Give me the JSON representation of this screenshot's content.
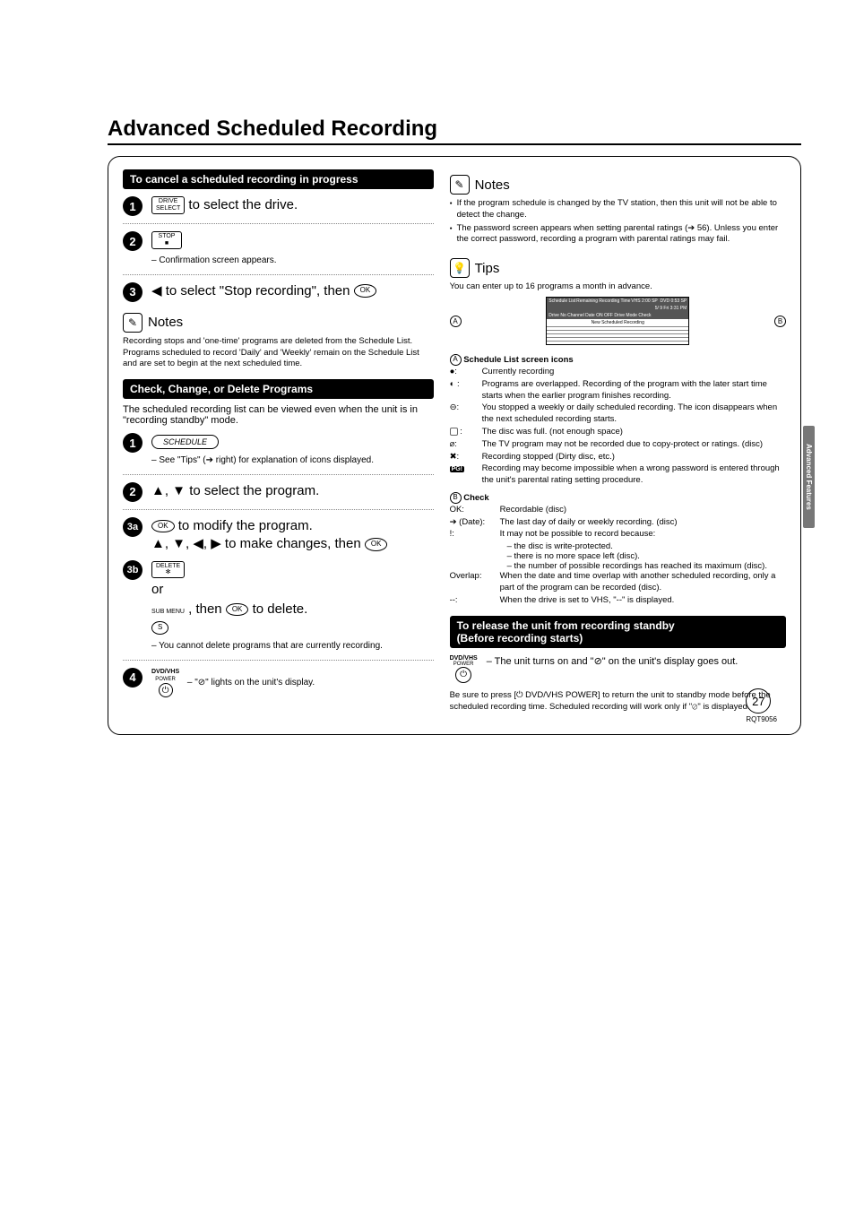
{
  "title": "Advanced Scheduled Recording",
  "side_tab": "Advanced Features",
  "page_number": "27",
  "page_code": "RQT9056",
  "left": {
    "cancel_heading": "To cancel a scheduled recording in progress",
    "step1_btn_top": "DRIVE",
    "step1_btn_bot": "SELECT",
    "step1_text": " to select the drive.",
    "step2_btn_top": "STOP",
    "step2_btn_sym": "■",
    "step2_sub": "– Confirmation screen appears.",
    "step3_text_a": "◀ to select \"Stop recording\", then ",
    "ok_label": "OK",
    "notes_heading": "Notes",
    "notes_body": "Recording stops and 'one-time' programs are deleted from the Schedule List.  Programs scheduled to record 'Daily' and 'Weekly' remain on the Schedule List and are set to begin at the next scheduled time.",
    "check_heading": "Check, Change, or Delete Programs",
    "check_intro": "The scheduled recording list can be viewed even when the unit is in \"recording standby\" mode.",
    "sched_btn": "SCHEDULE",
    "step1b_sub": "– See \"Tips\" (➔ right) for explanation of icons displayed.",
    "step2b_text": "▲, ▼ to select the program.",
    "step3a_text1": " to modify the program.",
    "step3a_text2": "▲, ▼, ◀, ▶ to make changes, then ",
    "step3b_del": "DELETE",
    "step3b_del_sym": "✻",
    "step3b_or": "or",
    "step3b_sub": "SUB MENU",
    "step3b_s": "S",
    "step3b_text": ", then ",
    "step3b_text2": " to delete.",
    "step3b_note": "– You cannot delete programs that are currently recording.",
    "step4_btn1": "DVD/VHS",
    "step4_btn2": "POWER",
    "step4_text": "– \"⊘\" lights on the unit's display."
  },
  "right": {
    "notes_heading": "Notes",
    "notes_items": [
      "If the program schedule is changed by the TV station, then this unit will not be able to detect the change.",
      "The password screen appears when setting parental ratings (➔ 56). Unless you enter the correct password, recording a program with parental ratings may fail."
    ],
    "tips_heading": "Tips",
    "tips_intro": "You can enter up to 16 programs a month in advance.",
    "table": {
      "title": "Schedule List",
      "remain": "Remaining Recording Time",
      "vhs": "VHS  2:00 SP",
      "dvd": "DVD  0:53 SP",
      "date_line": "5/ 9 Fri    3:31 PM",
      "cols": "Drive  No  Channel       Date           ON          OFF       Drive   Mode   Check",
      "empty": "New Scheduled Recording"
    },
    "letter_a": "A",
    "letter_b": "B",
    "a_heading": "Schedule List screen icons",
    "icons": [
      {
        "ic": "●:",
        "tx": "Currently recording"
      },
      {
        "ic": "◐ :",
        "tx": "Programs are overlapped. Recording of the program with the later start time starts when the earlier program finishes recording."
      },
      {
        "ic": "⊖:",
        "tx": "You stopped a weekly or daily scheduled recording. The icon disappears when the next scheduled recording starts."
      },
      {
        "ic": "F :",
        "tx": "The disc was full. (not enough space)"
      },
      {
        "ic": "⌀:",
        "tx": "The TV program may not be recorded due to copy-protect or ratings. (disc)"
      },
      {
        "ic": "✖:",
        "tx": "Recording stopped (Dirty disc, etc.)"
      }
    ],
    "pg_label": "PG!",
    "pg_text": "Recording may become impossible when a wrong password is entered through the unit's parental rating setting procedure.",
    "b_heading": "Check",
    "checks": [
      {
        "ic": "OK:",
        "tx": "Recordable (disc)"
      },
      {
        "ic": "➔ (Date):",
        "tx": "The last day of daily or weekly recording. (disc)"
      },
      {
        "ic": "!:",
        "tx": "It may not be possible to record because:"
      }
    ],
    "check_reasons": [
      "the disc is write-protected.",
      "there is no more space left (disc).",
      "the number of possible recordings has reached its maximum (disc)."
    ],
    "overlap_label": "Overlap:",
    "overlap_text": "When the date and time overlap with another scheduled recording, only a part of the program can be recorded (disc).",
    "dash_label": "--:",
    "dash_text": "When the drive is set to VHS, \"--\" is displayed.",
    "release_heading": "To release the unit from recording standby",
    "release_sub": "(Before recording starts)",
    "rel_btn1": "DVD/VHS",
    "rel_btn2": "POWER",
    "rel_text": "– The unit turns on and \"⊘\" on the unit's display goes out.",
    "rel_note": "Be sure to press [⏻ DVD/VHS POWER] to return the unit to standby mode before the scheduled recording time. Scheduled recording will work only if \"⊘\" is displayed."
  }
}
